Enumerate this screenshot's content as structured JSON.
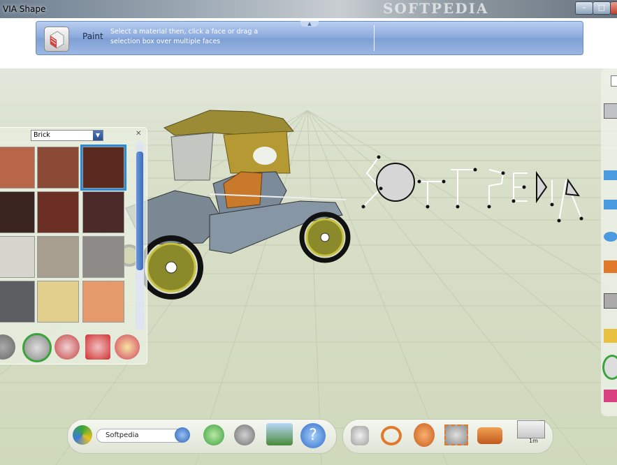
{
  "window": {
    "title": "VIA Shape",
    "watermark": "SOFTPEDIA"
  },
  "paint_bar": {
    "label": "Paint",
    "hint_line1": "Select a material then, click a face or drag a",
    "hint_line2": "selection box over multiple faces"
  },
  "material_panel": {
    "category": "Brick",
    "swatch_colors": [
      "#b8664a",
      "#8a4a36",
      "#5a2a20",
      "#3a2420",
      "#6a2e24",
      "#4a2a28",
      "#d6d4cc",
      "#a89e90",
      "#8c8a86",
      "#5c5e62",
      "#e2cf8e",
      "#e49a6a"
    ],
    "selected_swatch": 2
  },
  "viewport": {
    "watermark": "SOFTPEDIA",
    "sketch_text": "SOFTPEDIA"
  },
  "bottom_bar": {
    "search_value": "Softpedia",
    "unit": "1m"
  }
}
